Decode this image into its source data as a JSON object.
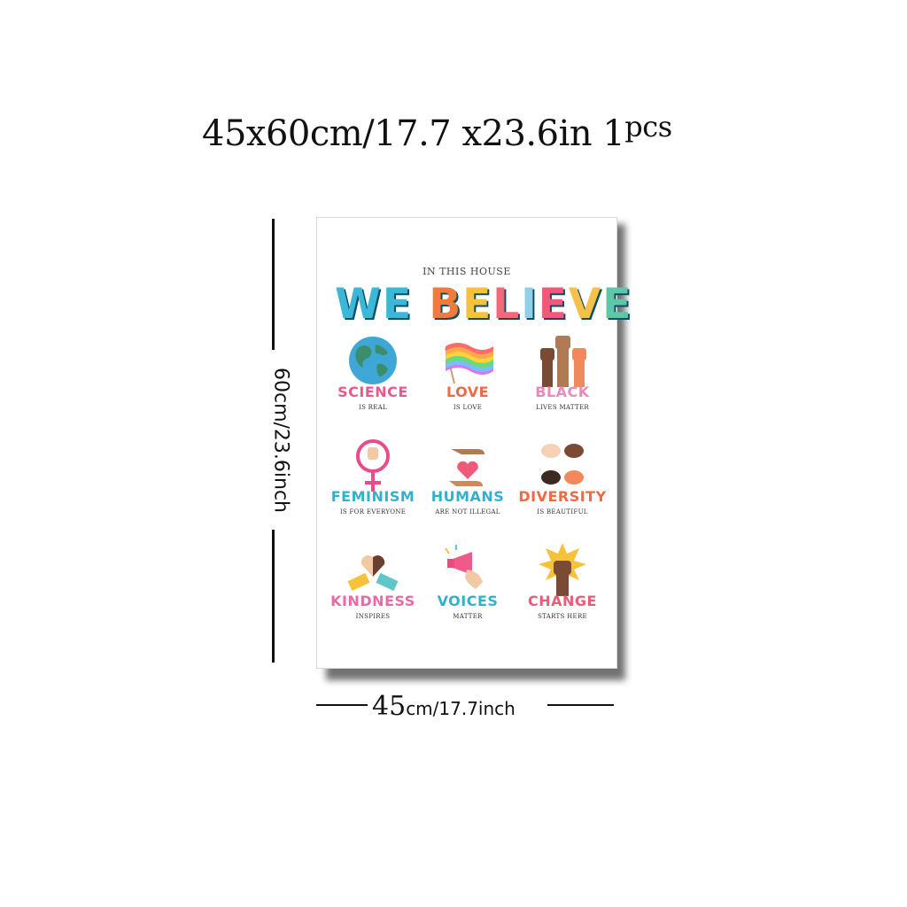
{
  "dimensions_title": {
    "main": "45x60cm/17.7 x23.6in 1",
    "pcs": "pcs"
  },
  "vertical_label": "60cm/23.6inch",
  "horizontal_label": {
    "big": "45",
    "small": "cm/17.7inch"
  },
  "poster": {
    "eyebrow": "IN THIS HOUSE",
    "headline_letters": [
      {
        "ch": "W",
        "color": "#3db7d8"
      },
      {
        "ch": "E",
        "color": "#3db7d8"
      },
      {
        "ch": " ",
        "color": "#ffffff"
      },
      {
        "ch": "B",
        "color": "#f27a3a"
      },
      {
        "ch": "E",
        "color": "#f5c23a"
      },
      {
        "ch": "L",
        "color": "#f26a7a"
      },
      {
        "ch": "I",
        "color": "#8fd0e8"
      },
      {
        "ch": "E",
        "color": "#f0597a"
      },
      {
        "ch": "V",
        "color": "#f6c04a"
      },
      {
        "ch": "E",
        "color": "#5fc7a8"
      }
    ],
    "items": [
      {
        "word": "SCIENCE",
        "sub": "IS REAL",
        "color": "#e65b8a",
        "icon": "globe-icon"
      },
      {
        "word": "LOVE",
        "sub": "IS LOVE",
        "color": "#ef6a44",
        "icon": "rainbow-flag-icon"
      },
      {
        "word": "BLACK",
        "sub": "LIVES MATTER",
        "color": "#e88bb9",
        "icon": "raised-fists-icon"
      },
      {
        "word": "FEMINISM",
        "sub": "IS FOR EVERYONE",
        "color": "#33b1cc",
        "icon": "female-symbol-icon"
      },
      {
        "word": "HUMANS",
        "sub": "ARE NOT ILLEGAL",
        "color": "#33b1cc",
        "icon": "hands-heart-icon"
      },
      {
        "word": "DIVERSITY",
        "sub": "IS BEAUTIFUL",
        "color": "#ef6a44",
        "icon": "diverse-hands-icon"
      },
      {
        "word": "KINDNESS",
        "sub": "INSPIRES",
        "color": "#ea6aa6",
        "icon": "heart-hands-icon"
      },
      {
        "word": "VOICES",
        "sub": "MATTER",
        "color": "#33b1cc",
        "icon": "megaphone-icon"
      },
      {
        "word": "CHANGE",
        "sub": "STARTS HERE",
        "color": "#ea5c78",
        "icon": "fist-burst-icon"
      }
    ]
  }
}
